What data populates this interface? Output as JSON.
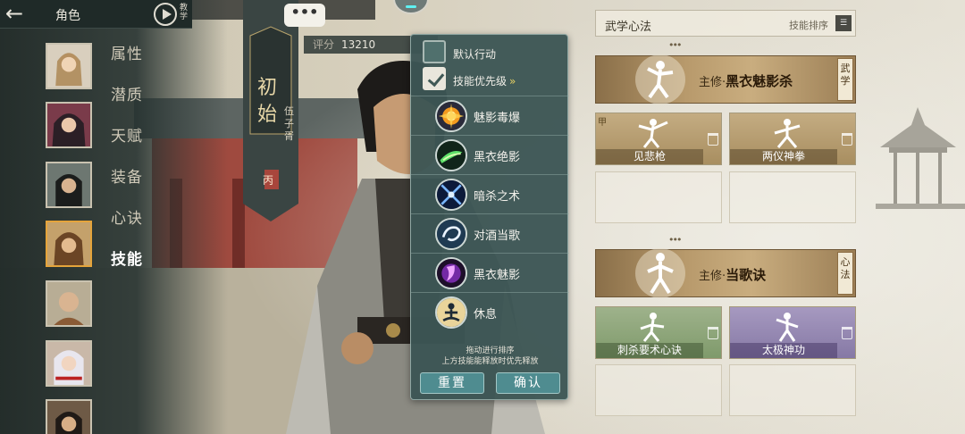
{
  "header": {
    "title": "角色",
    "tutorial_label": "教学"
  },
  "sidebar": {
    "menu": [
      {
        "label": "属性",
        "active": false
      },
      {
        "label": "潜质",
        "active": false
      },
      {
        "label": "天赋",
        "active": false
      },
      {
        "label": "装备",
        "active": false
      },
      {
        "label": "心诀",
        "active": false
      },
      {
        "label": "技能",
        "active": true
      }
    ],
    "selected_avatar_index": 3
  },
  "chat_bubble": "•••",
  "banner": {
    "name": "初始",
    "character": "伍子胥",
    "badge": "丙"
  },
  "score": {
    "label": "评分",
    "value": "13210"
  },
  "popup": {
    "default_action": {
      "label": "默认行动",
      "checked": false
    },
    "skill_priority": {
      "label": "技能优先级",
      "checked": true,
      "arrow": "»"
    },
    "skills": [
      {
        "name": "魅影毒爆",
        "icon": "burst-orange-icon"
      },
      {
        "name": "黑衣绝影",
        "icon": "green-slash-icon"
      },
      {
        "name": "暗杀之术",
        "icon": "blue-cross-blade-icon"
      },
      {
        "name": "对酒当歌",
        "icon": "swirl-white-icon"
      },
      {
        "name": "黑衣魅影",
        "icon": "purple-shadow-icon"
      },
      {
        "name": "休息",
        "icon": "meditate-icon"
      }
    ],
    "hint_line1": "拖动进行排序",
    "hint_line2": "上方技能能释放时优先释放",
    "reset_label": "重置",
    "confirm_label": "确认"
  },
  "right_panel": {
    "title": "武学心法",
    "sort_label": "技能排序",
    "martial": {
      "main_prefix": "主修·",
      "main_name": "黑衣魅影杀",
      "tag": "武学",
      "corner_mark": "甲",
      "subs": [
        {
          "name": "见悲枪"
        },
        {
          "name": "两仪神拳"
        }
      ]
    },
    "mind": {
      "main_prefix": "主修·",
      "main_name": "当歌诀",
      "tag": "心法",
      "subs": [
        {
          "name": "刺杀要术心诀"
        },
        {
          "name": "太极神功"
        }
      ]
    }
  },
  "colors": {
    "accent_gold": "#e5a43b",
    "popup_bg": "#3c5554",
    "button_teal": "#4f8c90"
  }
}
